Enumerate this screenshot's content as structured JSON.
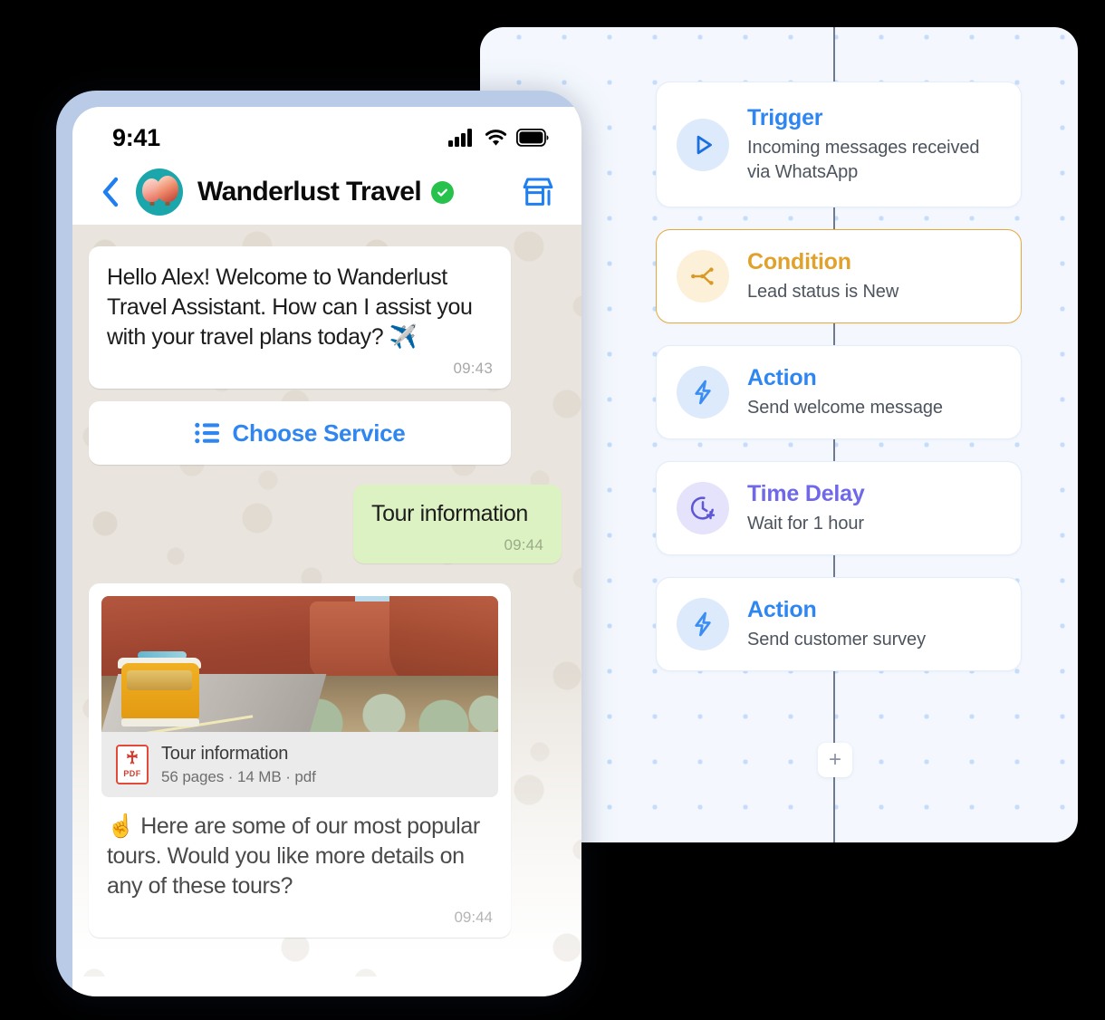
{
  "workflow": {
    "add_node_label": "+",
    "nodes": [
      {
        "icon": "play-icon",
        "title": "Trigger",
        "desc": "Incoming messages received via WhatsApp",
        "theme": "blue",
        "accent": "#2f86f0"
      },
      {
        "icon": "branch-icon",
        "title": "Condition",
        "desc": "Lead status is New",
        "theme": "amber",
        "accent": "#e0a22c"
      },
      {
        "icon": "bolt-icon",
        "title": "Action",
        "desc": "Send welcome message",
        "theme": "blue",
        "accent": "#2f86f0"
      },
      {
        "icon": "clock-plus-icon",
        "title": "Time Delay",
        "desc": "Wait for 1 hour",
        "theme": "purple",
        "accent": "#6f68e8"
      },
      {
        "icon": "bolt-icon",
        "title": "Action",
        "desc": "Send customer survey",
        "theme": "blue",
        "accent": "#2f86f0"
      }
    ]
  },
  "phone": {
    "status": {
      "time": "9:41",
      "cellular_icon": "signal-bars-icon",
      "wifi_icon": "wifi-icon",
      "battery_icon": "battery-full-icon"
    },
    "header": {
      "back_icon": "back-chevron-icon",
      "avatar_icon": "hot-air-balloon-avatar",
      "title": "Wanderlust Travel",
      "verified_icon": "verified-check-icon",
      "store_icon": "storefront-icon"
    },
    "messages": [
      {
        "type": "incoming",
        "text": "Hello Alex! Welcome to Wanderlust Travel Assistant. How can I assist you with your travel plans today? ✈️",
        "time": "09:43"
      },
      {
        "type": "button",
        "icon": "list-icon",
        "label": "Choose Service"
      },
      {
        "type": "outgoing",
        "text": "Tour information",
        "time": "09:44"
      },
      {
        "type": "media",
        "image_icon": "desert-road-van-photo",
        "file_name": "Tour information",
        "file_meta": "56 pages · 14 MB · pdf",
        "file_type_label": "PDF",
        "text": "☝️ Here are some of our most popular tours. Would you like more details on any of these tours?",
        "time": "09:44"
      }
    ]
  },
  "colors": {
    "page_background": "#000000",
    "panel_background": "#f4f8fe",
    "dot_grid": "#c5dcfb",
    "phone_frame": "#b9cbe6",
    "chat_background": "#e9e4dd",
    "outgoing_bubble": "#ddf2c3",
    "accent_blue": "#2f86f0",
    "accent_amber": "#e0a22c",
    "accent_purple": "#6f68e8",
    "verified_green": "#27c24c"
  }
}
